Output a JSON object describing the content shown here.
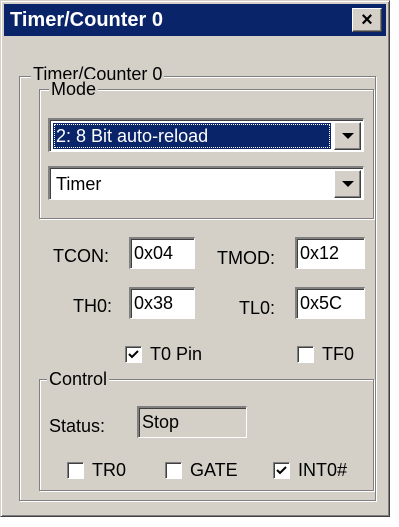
{
  "window": {
    "title": "Timer/Counter 0",
    "close_glyph": "×"
  },
  "group": {
    "label": "Timer/Counter 0"
  },
  "mode": {
    "label": "Mode",
    "mode_select": "2: 8 Bit auto-reload",
    "type_select": "Timer"
  },
  "registers": {
    "tcon_label": "TCON:",
    "tcon_value": "0x04",
    "tmod_label": "TMOD:",
    "tmod_value": "0x12",
    "th0_label": "TH0:",
    "th0_value": "0x38",
    "tl0_label": "TL0:",
    "tl0_value": "0x5C"
  },
  "pins": {
    "t0_pin": {
      "label": "T0 Pin",
      "checked": true
    },
    "tf0": {
      "label": "TF0",
      "checked": false
    }
  },
  "control": {
    "label": "Control",
    "status_label": "Status:",
    "status_value": "Stop",
    "tr0": {
      "label": "TR0",
      "checked": false
    },
    "gate": {
      "label": "GATE",
      "checked": false
    },
    "int0": {
      "label": "INT0#",
      "checked": true
    }
  },
  "icons": {
    "close": "close-icon",
    "dropdown": "chevron-down-icon",
    "check": "checkmark-icon"
  },
  "colors": {
    "titlebar": "#0a246a",
    "face": "#d4d0c8",
    "selection": "#0a246a"
  }
}
